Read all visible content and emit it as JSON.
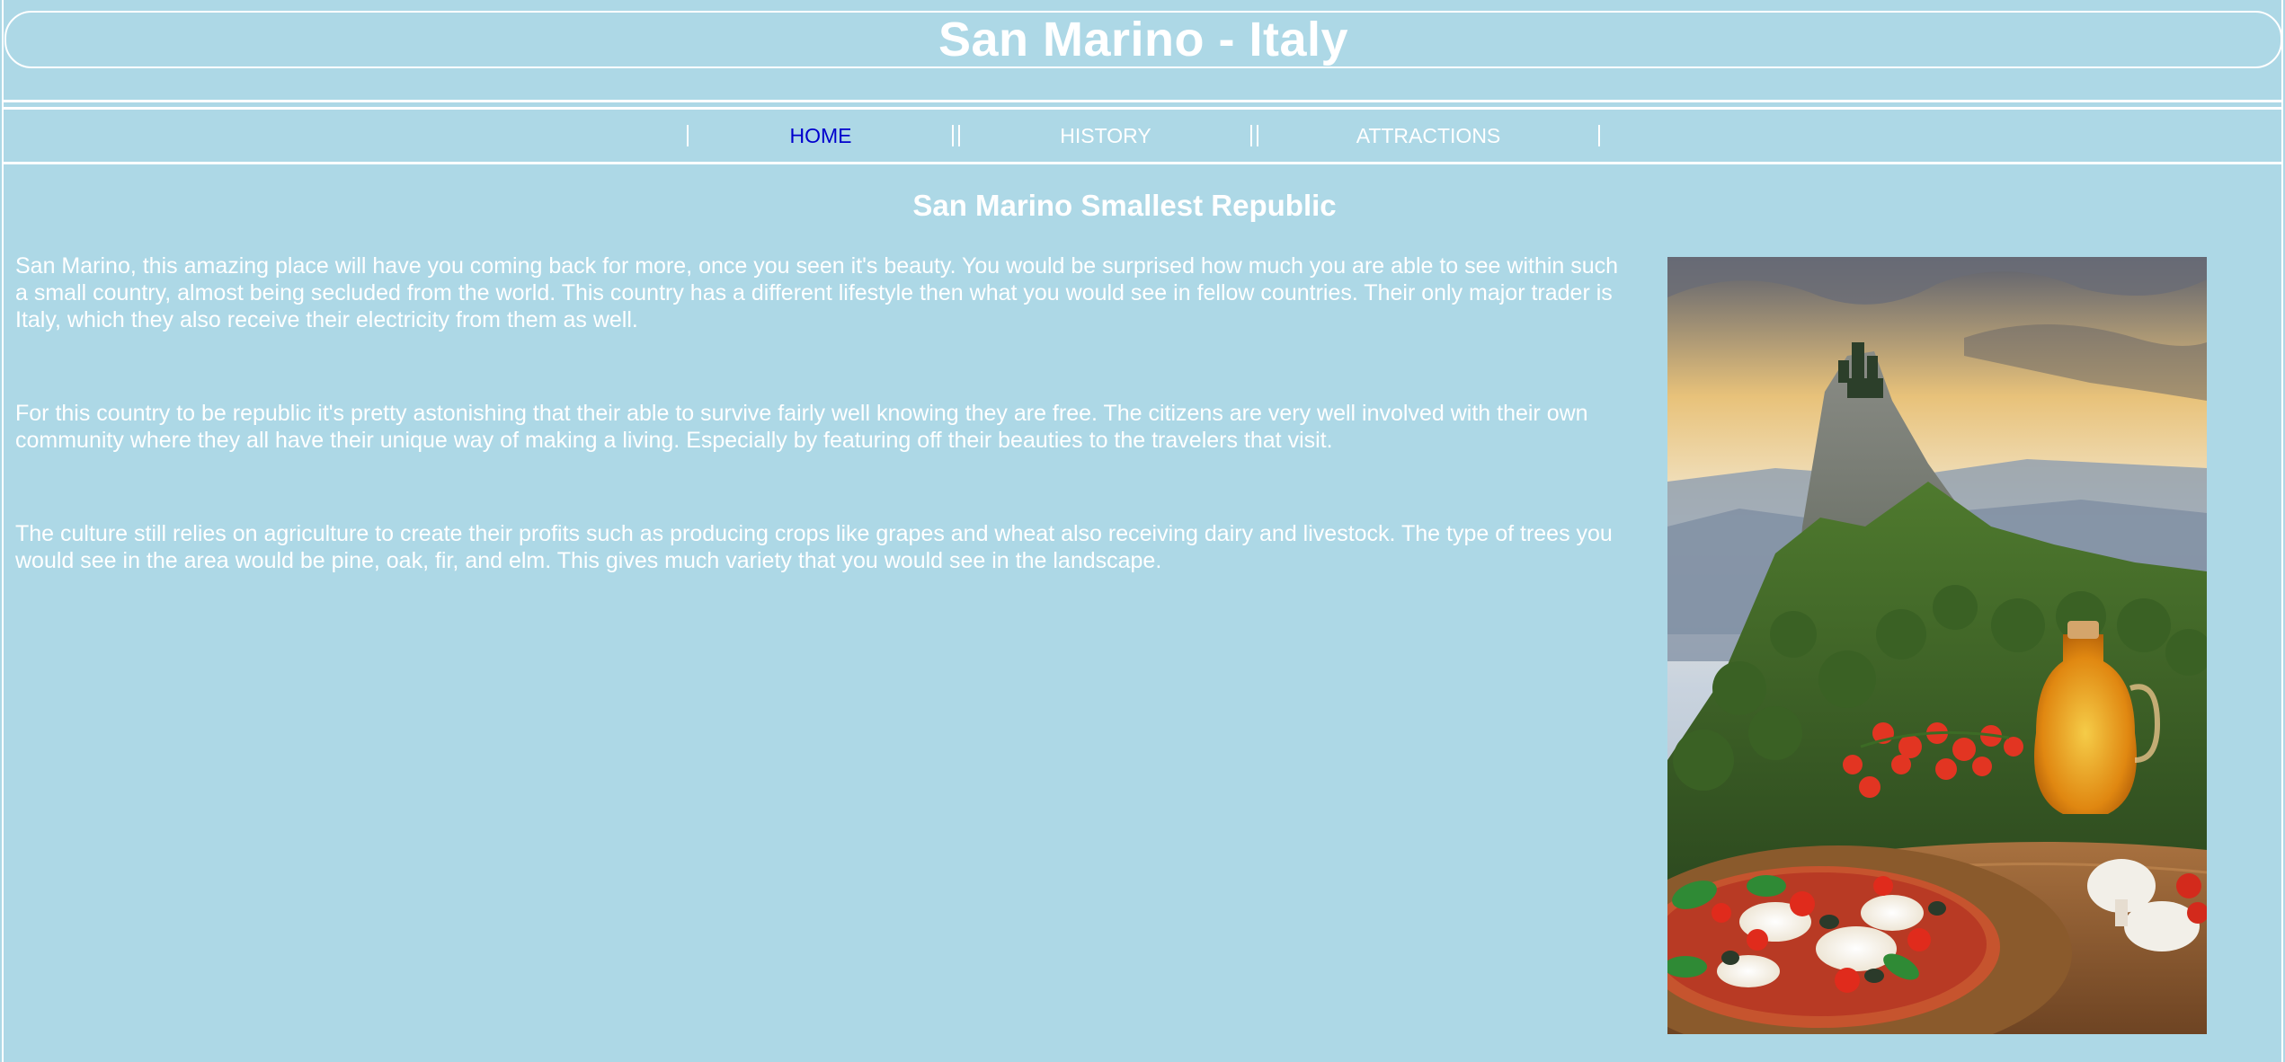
{
  "header": {
    "title": "San Marino - Italy"
  },
  "nav": {
    "items": [
      {
        "label": "HOME",
        "active": true
      },
      {
        "label": "HISTORY",
        "active": false
      },
      {
        "label": "ATTRACTIONS",
        "active": false
      }
    ]
  },
  "main": {
    "heading": "San Marino Smallest Republic",
    "paragraphs": [
      "San Marino, this amazing place will have you coming back for more, once you seen it's beauty. You would be surprised how much you are able to see within such a small country, almost being secluded from the world. This country has a different lifestyle then what you would see in fellow countries. Their only major trader is Italy, which they also receive their electricity from them as well.",
      "For this country to be republic it's pretty astonishing that their able to survive fairly well knowing they are free. The citizens are very well involved with their own community where they all have their unique way of making a living. Especially by featuring off their beauties to the travelers that visit.",
      "The culture still relies on agriculture to create their profits such as producing crops like grapes and wheat also receiving dairy and livestock. The type of trees you would see in the area would be pine, oak, fir, and elm. This gives much variety that you would see in the landscape."
    ]
  },
  "colors": {
    "background": "#add8e6",
    "text": "#ffffff",
    "active_link": "#0000cd"
  }
}
